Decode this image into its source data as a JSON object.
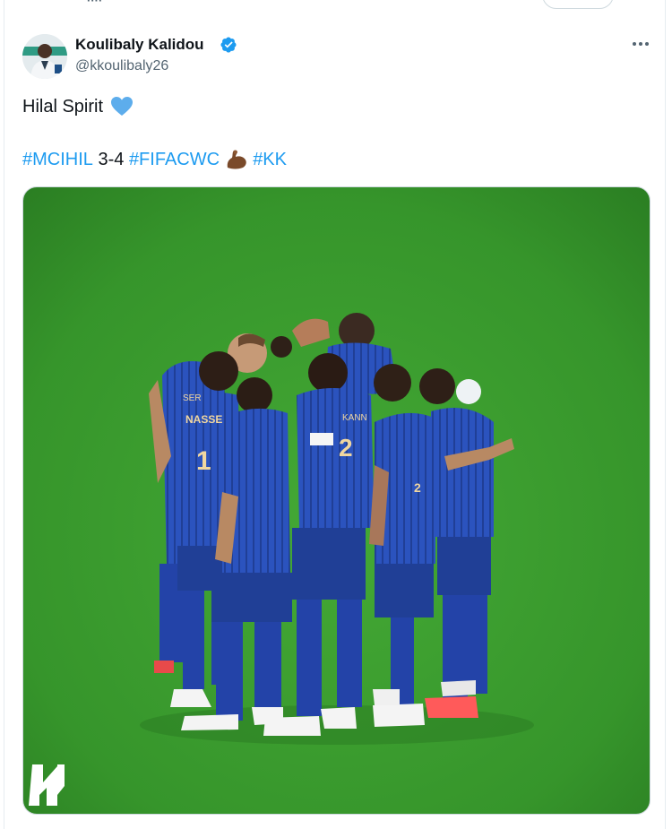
{
  "author": {
    "name": "Koulibaly Kalidou",
    "handle": "@kkoulibaly26",
    "verified": true
  },
  "tweet": {
    "line1_text": "Hilal Spirit",
    "line1_emoji": "blue-heart-icon",
    "line2": {
      "tag1": "#MCIHIL",
      "score": "3-4",
      "tag2": "#FIFACWC",
      "emoji": "flexed-biceps-icon",
      "tag3": "#KK"
    }
  },
  "media": {
    "jersey_labels": [
      "SER",
      "NASSE",
      "1",
      "KANN",
      "2",
      "2"
    ],
    "logo": "al-hilal-logo"
  },
  "colors": {
    "hashtag": "#1d9bf0",
    "verified": "#1d9bf0",
    "secondary_text": "#536471",
    "pitch": "#3a9a2e",
    "kit": "#2a4fb8"
  }
}
